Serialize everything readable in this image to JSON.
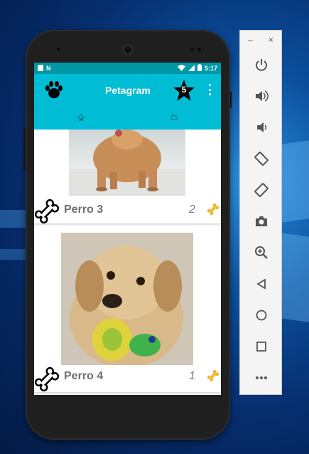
{
  "status_bar": {
    "time": "5:17",
    "left_icons": [
      "sd-card-icon",
      "notification-n-icon"
    ],
    "right_icons": [
      "wifi-icon",
      "signal-icon",
      "battery-icon"
    ]
  },
  "toolbar": {
    "title": "Petagram",
    "rating_count": "5"
  },
  "tabs": [
    {
      "icon": "home-icon"
    },
    {
      "icon": "dog-icon"
    }
  ],
  "pets": [
    {
      "name": "Perro 3",
      "likes": "2"
    },
    {
      "name": "Perro 4",
      "likes": "1"
    }
  ],
  "colors": {
    "accent": "#00bcd4",
    "status_bar": "#0097a7",
    "bone_gold": "#f2b632"
  },
  "emulator_panel": {
    "window_controls": [
      "–",
      "×"
    ],
    "buttons": [
      "power-icon",
      "volume-up-icon",
      "volume-down-icon",
      "rotate-left-icon",
      "rotate-right-icon",
      "camera-icon",
      "zoom-in-icon",
      "back-icon",
      "home-circle-icon",
      "overview-square-icon",
      "more-icon"
    ]
  }
}
